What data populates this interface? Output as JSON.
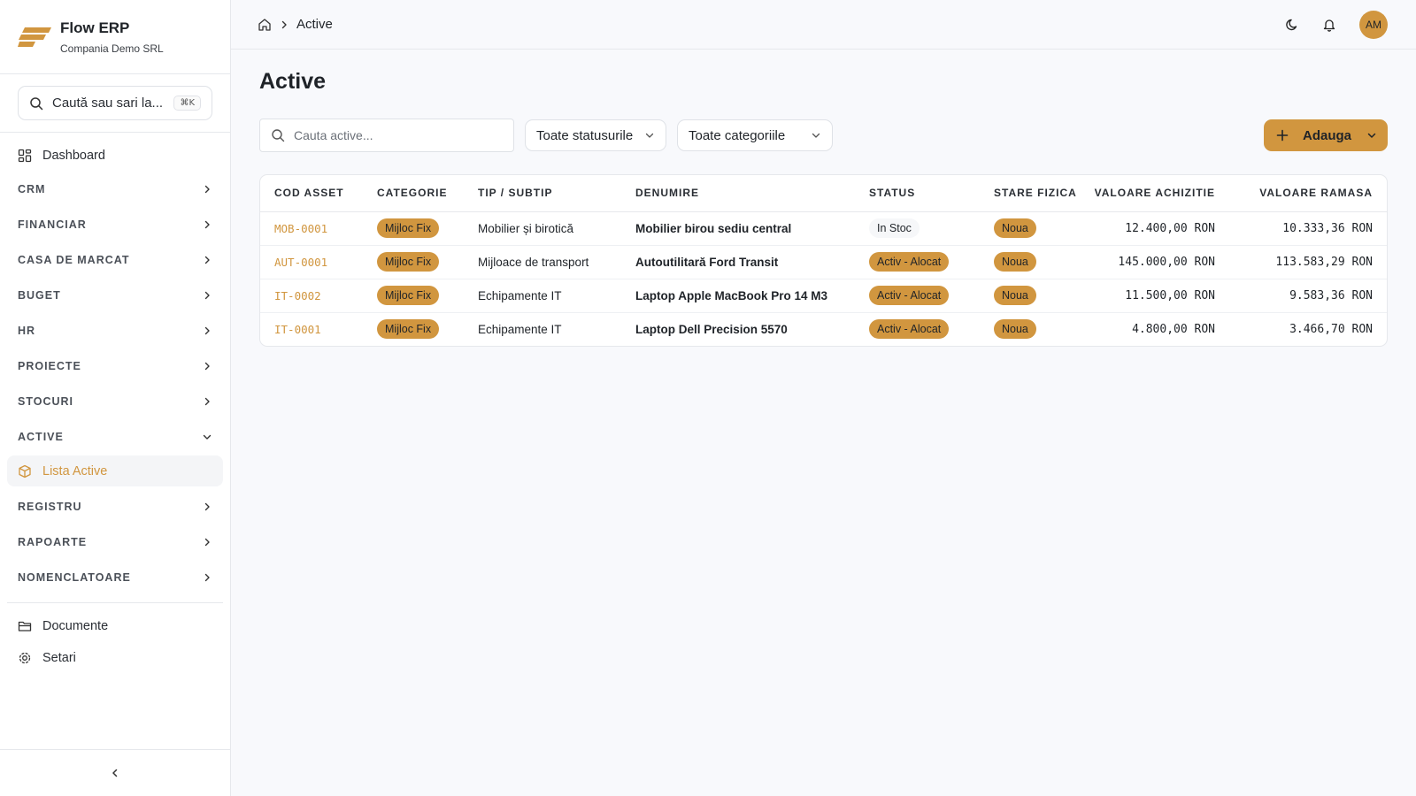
{
  "brand": {
    "name": "Flow ERP",
    "company": "Compania Demo SRL",
    "accent": "#d1963f"
  },
  "sidebar": {
    "search_placeholder": "Caută sau sari la...",
    "shortcut": "⌘K",
    "dashboard": "Dashboard",
    "groups": [
      "CRM",
      "FINANCIAR",
      "CASA DE MARCAT",
      "BUGET",
      "HR",
      "PROIECTE",
      "STOCURI"
    ],
    "active_group": "ACTIVE",
    "active_item": "Lista Active",
    "groups_after": [
      "REGISTRU",
      "RAPOARTE",
      "NOMENCLATOARE"
    ],
    "documents": "Documente",
    "settings": "Setari"
  },
  "topbar": {
    "breadcrumb_current": "Active",
    "avatar": "AM"
  },
  "main": {
    "title": "Active",
    "search_placeholder": "Cauta active...",
    "status_filter": "Toate statusurile",
    "category_filter": "Toate categoriile",
    "add_label": "Adauga"
  },
  "table": {
    "headers": [
      "COD ASSET",
      "CATEGORIE",
      "TIP / SUBTIP",
      "DENUMIRE",
      "STATUS",
      "STARE FIZICA",
      "VALOARE ACHIZITIE",
      "VALOARE RAMASA"
    ],
    "rows": [
      {
        "code": "MOB-0001",
        "category": "Mijloc Fix",
        "type": "Mobilier și birotică",
        "name": "Mobilier birou sediu central",
        "status": "In Stoc",
        "condition": "Noua",
        "purchase": "12.400,00 RON",
        "remaining": "10.333,36 RON"
      },
      {
        "code": "AUT-0001",
        "category": "Mijloc Fix",
        "type": "Mijloace de transport",
        "name": "Autoutilitară Ford Transit",
        "status": "Activ - Alocat",
        "condition": "Noua",
        "purchase": "145.000,00 RON",
        "remaining": "113.583,29 RON"
      },
      {
        "code": "IT-0002",
        "category": "Mijloc Fix",
        "type": "Echipamente IT",
        "name": "Laptop Apple MacBook Pro 14 M3",
        "status": "Activ - Alocat",
        "condition": "Noua",
        "purchase": "11.500,00 RON",
        "remaining": "9.583,36 RON"
      },
      {
        "code": "IT-0001",
        "category": "Mijloc Fix",
        "type": "Echipamente IT",
        "name": "Laptop Dell Precision 5570",
        "status": "Activ - Alocat",
        "condition": "Noua",
        "purchase": "4.800,00 RON",
        "remaining": "3.466,70 RON"
      }
    ]
  }
}
